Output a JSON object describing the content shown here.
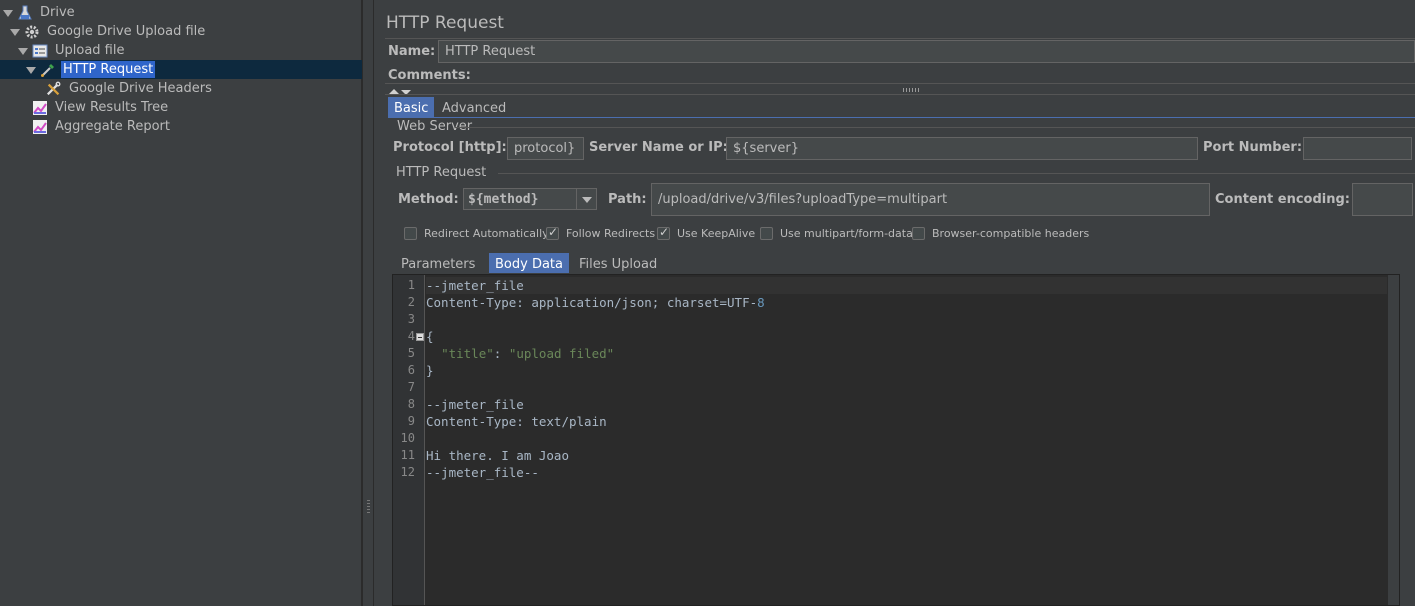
{
  "tree": {
    "items": [
      {
        "label": "Drive",
        "icon": "flask-icon"
      },
      {
        "label": "Google Drive Upload file",
        "icon": "gear-icon"
      },
      {
        "label": "Upload file",
        "icon": "controller-icon"
      },
      {
        "label": "HTTP Request",
        "icon": "pipette-icon"
      },
      {
        "label": "Google Drive Headers",
        "icon": "wrench-icon"
      },
      {
        "label": "View Results Tree",
        "icon": "graph-icon"
      },
      {
        "label": "Aggregate Report",
        "icon": "graph-icon"
      }
    ]
  },
  "panel": {
    "title": "HTTP Request",
    "name_label": "Name:",
    "name_value": "HTTP Request",
    "comments_label": "Comments:"
  },
  "tabs": {
    "basic": "Basic",
    "advanced": "Advanced"
  },
  "web_server": {
    "group_title": "Web Server",
    "protocol_label": "Protocol [http]:",
    "protocol_value": "protocol}",
    "server_label": "Server Name or IP:",
    "server_value": "${server}",
    "port_label": "Port Number:",
    "port_value": ""
  },
  "http_request": {
    "group_title": "HTTP Request",
    "method_label": "Method:",
    "method_value": "${method}",
    "path_label": "Path:",
    "path_value": "/upload/drive/v3/files?uploadType=multipart",
    "encoding_label": "Content encoding:",
    "encoding_value": ""
  },
  "options": [
    {
      "label": "Redirect Automatically",
      "checked": false
    },
    {
      "label": "Follow Redirects",
      "checked": true
    },
    {
      "label": "Use KeepAlive",
      "checked": true
    },
    {
      "label": "Use multipart/form-data",
      "checked": false
    },
    {
      "label": "Browser-compatible headers",
      "checked": false
    }
  ],
  "sub_tabs": {
    "parameters": "Parameters",
    "body_data": "Body Data",
    "files_upload": "Files Upload"
  },
  "editor": {
    "line_numbers": [
      "1",
      "2",
      "3",
      "4",
      "5",
      "6",
      "7",
      "8",
      "9",
      "10",
      "11",
      "12"
    ],
    "lines": [
      "--jmeter_file",
      "Content-Type: application/json; charset=UTF-8",
      "",
      "{",
      "  \"title\": \"upload filed\"",
      "}",
      "",
      "--jmeter_file",
      "Content-Type: text/plain",
      "",
      "Hi there. I am Joao",
      "--jmeter_file--"
    ]
  },
  "colors": {
    "background": "#3c3f41",
    "selection": "#2f65ca",
    "active_tab": "#4b6eaf",
    "editor_bg": "#2b2b2b",
    "string": "#6a8759",
    "number": "#6897bb"
  }
}
